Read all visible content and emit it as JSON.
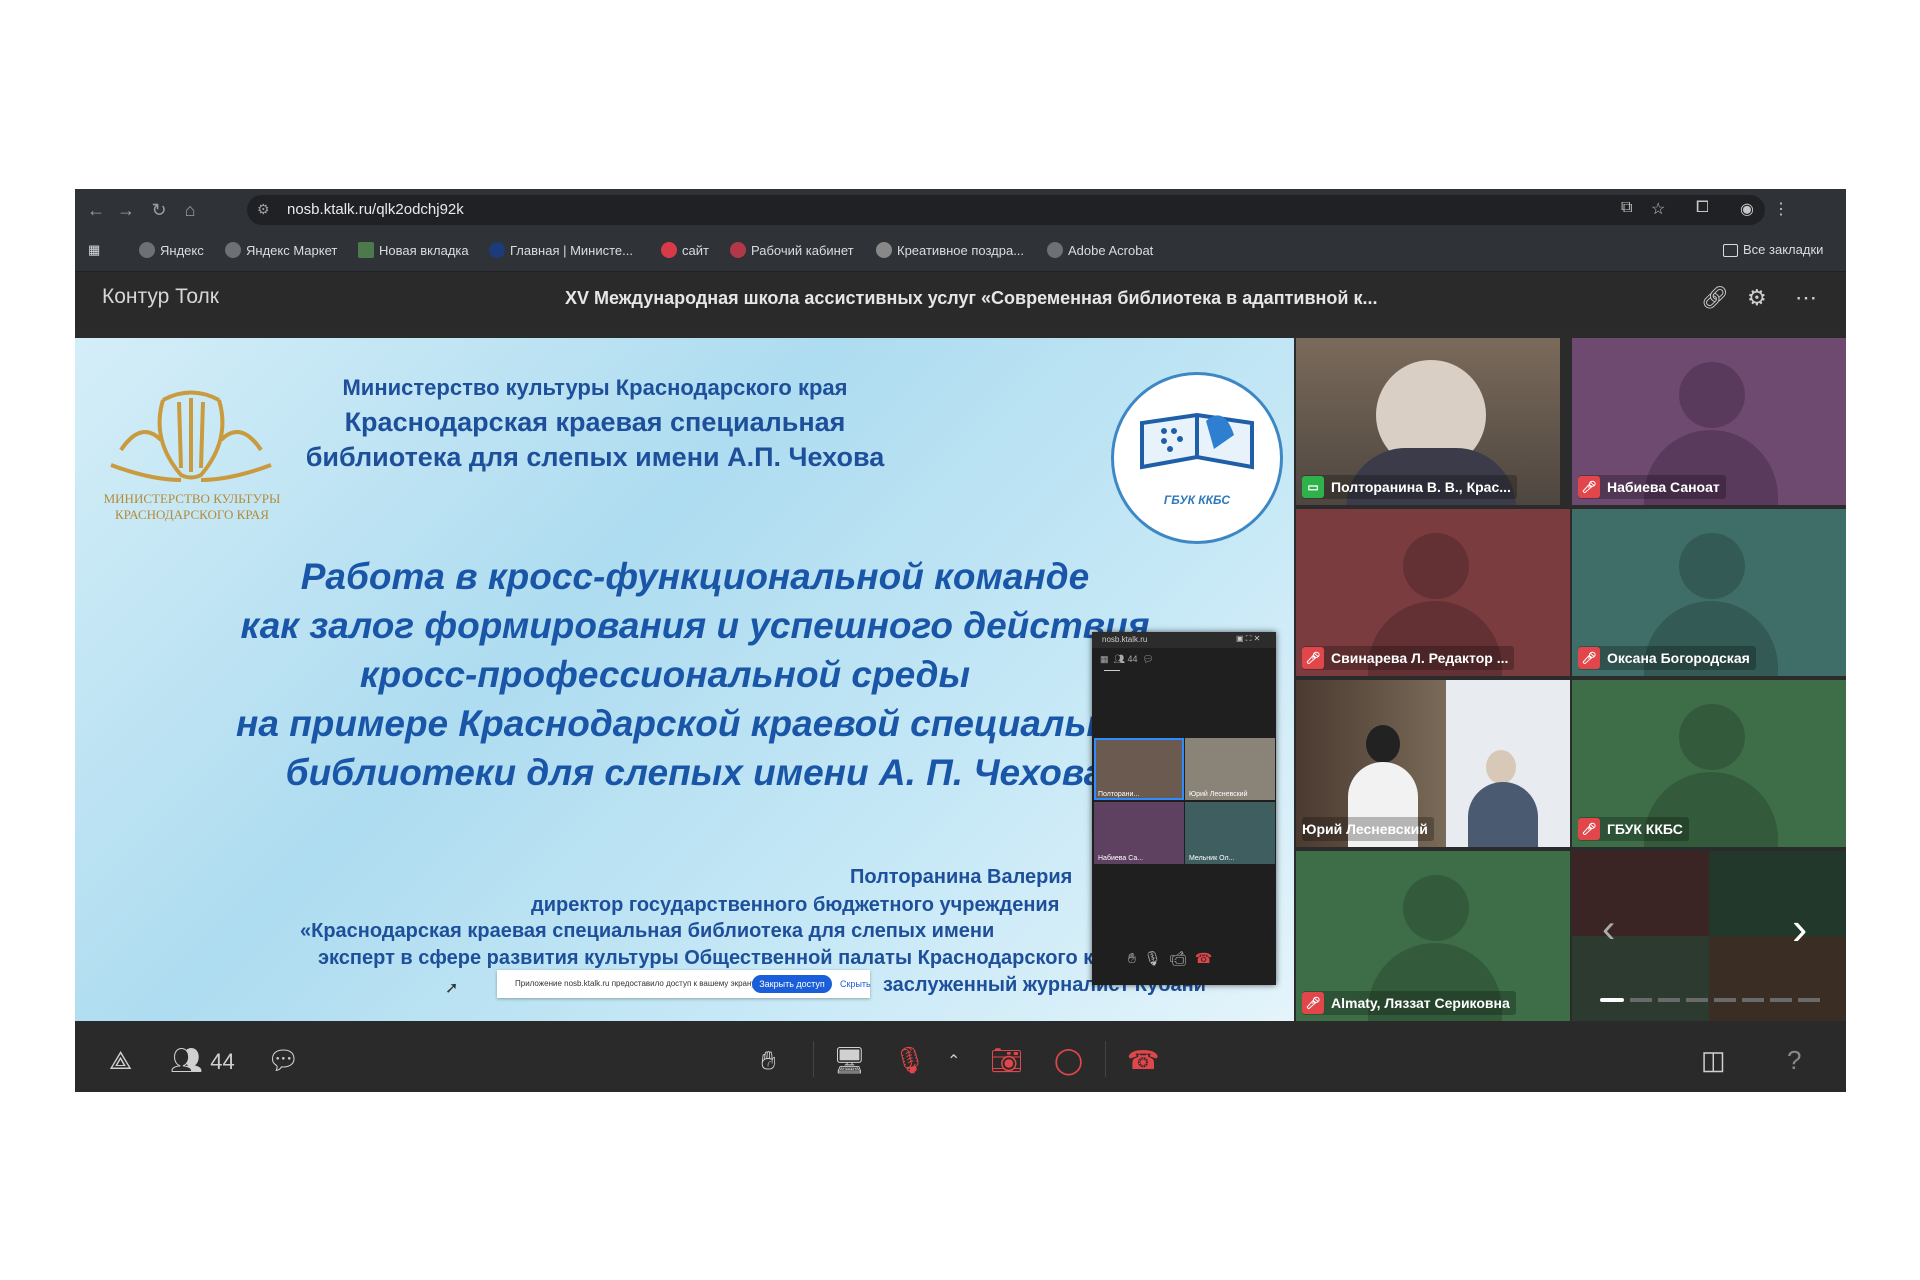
{
  "browser": {
    "url": "nosb.ktalk.ru/qlk2odchj92k",
    "bookmarks": [
      "Яндекс",
      "Яндекс Маркет",
      "Новая вкладка",
      "Главная | Министе...",
      "сайт",
      "Рабочий кабинет",
      "Креативное поздра...",
      "Adobe Acrobat"
    ],
    "all_bookmarks": "Все закладки"
  },
  "app": {
    "brand": "Контур Толк",
    "meeting_title": "XV Международная школа ассистивных услуг «Современная библиотека в адаптивной к..."
  },
  "slide": {
    "logo_caption_1": "МИНИСТЕРСТВО КУЛЬТУРЫ",
    "logo_caption_2": "КРАСНОДАРСКОГО КРАЯ",
    "right_logo_text": "ГБУК ККБС",
    "org_line_1": "Министерство культуры Краснодарского края",
    "org_line_2": "Краснодарская краевая специальная",
    "org_line_3": "библиотека для слепых имени А.П. Чехова",
    "title_lines": [
      "Работа в кросс-функциональной команде",
      "как залог формирования и успешного действия",
      "кросс-профессиональной среды",
      "на примере Краснодарской краевой специальной",
      "библиотеки для слепых имени А. П. Чехова"
    ],
    "author_lines": [
      "Полторанина Валерия",
      "директор государственного бюджетного учреждения",
      "«Краснодарская краевая специальная библиотека для слепых имени",
      "эксперт в сфере развития культуры Общественной палаты Краснодарского края",
      "заслуженный журналист Кубани"
    ]
  },
  "screen_share": {
    "text": "Приложение nosb.ktalk.ru предоставило доступ к вашему экрану.",
    "stop_button": "Закрыть доступ",
    "hide_button": "Скрыть"
  },
  "mini_window": {
    "title": "nosb.ktalk.ru",
    "count": "44",
    "tiles": [
      "Полторани...",
      "Юрий Лесневский",
      "Набиева Са...",
      "Мельник Ол..."
    ]
  },
  "participants": [
    {
      "name": "Полторанина В. В., Крас...",
      "status": "screen",
      "bg": "#5a5048"
    },
    {
      "name": "Набиева Саноат",
      "status": "muted",
      "bg": "#6e4a70"
    },
    {
      "name": "Свинарева Л. Редактор ...",
      "status": "muted",
      "bg": "#7a3c3e"
    },
    {
      "name": "Оксана Богородская",
      "status": "muted",
      "bg": "#3f6e68"
    },
    {
      "name": "Юрий Лесневский",
      "status": "none",
      "bg": "#8a8478"
    },
    {
      "name": "ГБУК ККБС",
      "status": "muted",
      "bg": "#3e6e48"
    },
    {
      "name": "Almaty, Ляззат Сериковна",
      "status": "muted",
      "bg": "#3e6e48"
    }
  ],
  "bottom": {
    "participants_count": "44"
  },
  "colors": {
    "accent_blue": "#2f8cff",
    "danger_red": "#e0464a",
    "screen_green": "#2eb24a"
  }
}
